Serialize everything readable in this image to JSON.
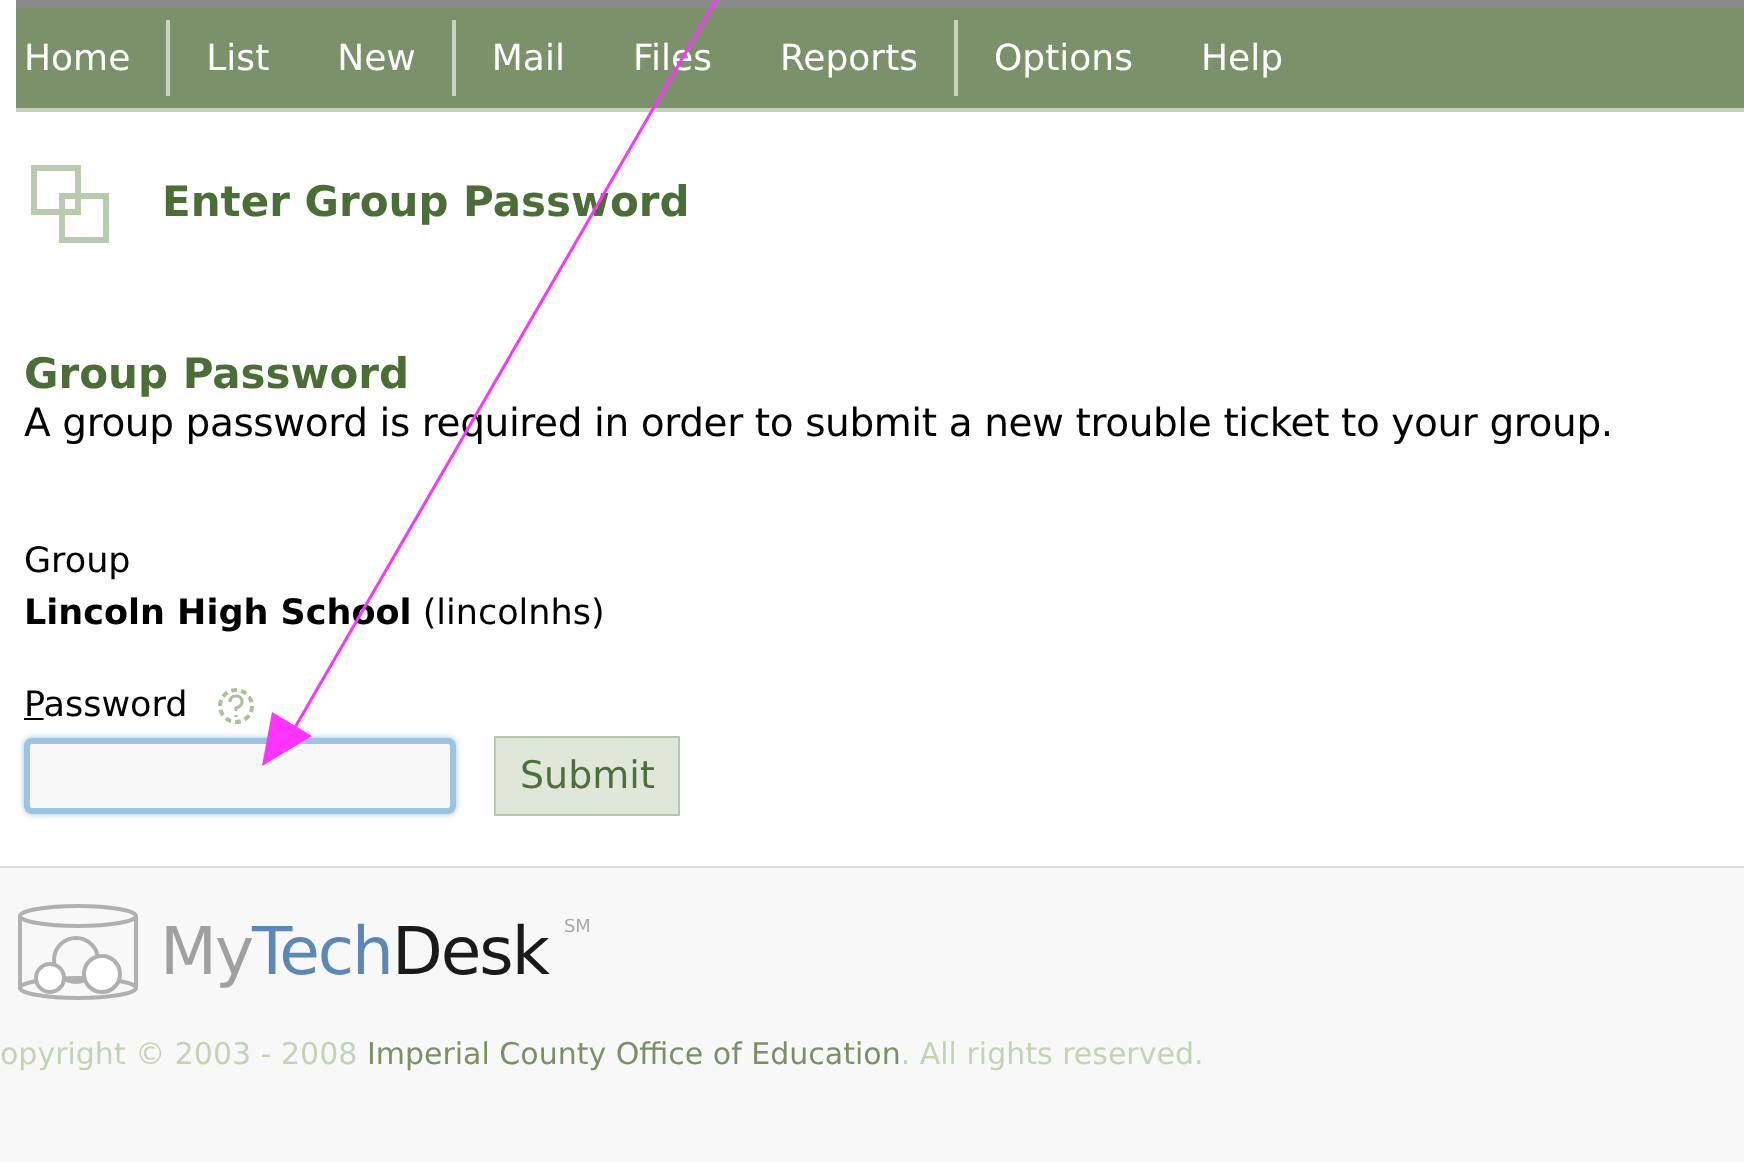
{
  "nav": {
    "groups": [
      [
        "Home"
      ],
      [
        "List",
        "New"
      ],
      [
        "Mail",
        "Files",
        "Reports"
      ],
      [
        "Options",
        "Help"
      ]
    ]
  },
  "page_title": "Enter Group Password",
  "section": {
    "title": "Group Password",
    "description": "A group password is required in order to submit a new trouble ticket to your group."
  },
  "group": {
    "label": "Group",
    "name": "Lincoln High School",
    "code": "(lincolnhs)"
  },
  "password": {
    "label": "Password",
    "focused": true
  },
  "submit": "Submit",
  "footer": {
    "logo_parts": [
      "My",
      "Tech",
      "Desk"
    ],
    "logo_mark": "SM",
    "copyright": "opyright © 2003 - 2008",
    "link": "Imperial County Office of Education",
    "rights": ". All rights reserved."
  },
  "annotation": {
    "kind": "arrow"
  }
}
